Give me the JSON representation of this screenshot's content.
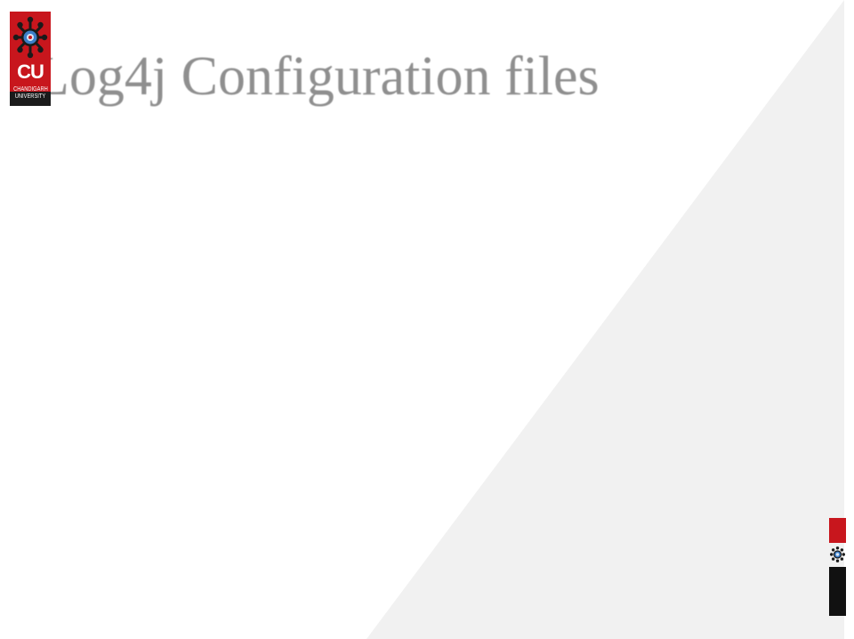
{
  "slide": {
    "title": "Log4j Configuration files"
  },
  "logo": {
    "initials": "CU",
    "name_line1": "CHANDIGARH",
    "name_line2": "UNIVERSITY",
    "emblem_icon": "gear-emblem-icon"
  },
  "corner_logo": {
    "emblem_icon": "gear-emblem-icon"
  },
  "colors": {
    "brand_red": "#c8161d",
    "brand_black": "#111111",
    "title_gray": "#8f8f8f",
    "triangle_gray": "#f1f1f1"
  }
}
